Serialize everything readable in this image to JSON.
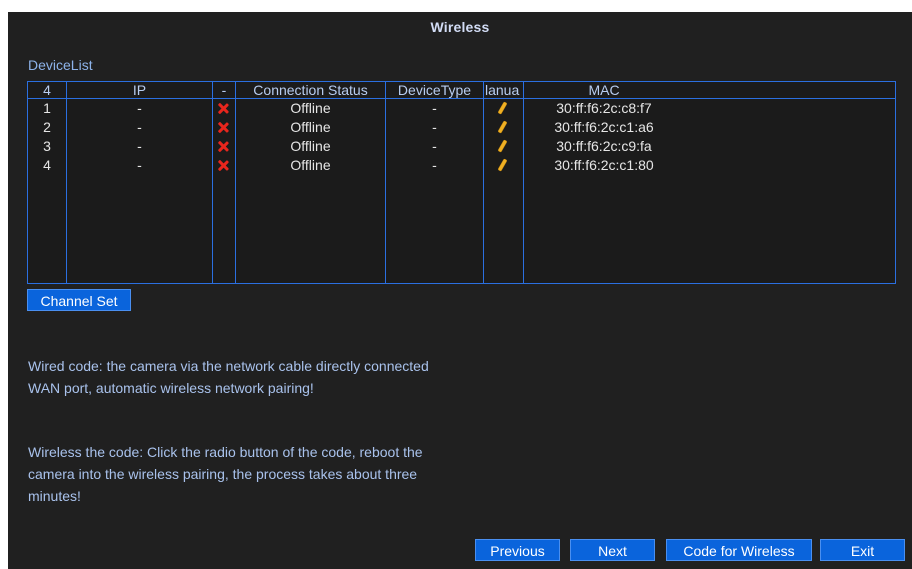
{
  "window": {
    "title": "Wireless"
  },
  "device_list": {
    "label": "DeviceList",
    "columns": [
      "4",
      "IP",
      "-",
      "Connection Status",
      "DeviceType",
      "lanua",
      "MAC"
    ],
    "rows": [
      {
        "index": "1",
        "ip": "-",
        "status": "Offline",
        "device_type": "-",
        "mac": "30:ff:f6:2c:c8:f7"
      },
      {
        "index": "2",
        "ip": "-",
        "status": "Offline",
        "device_type": "-",
        "mac": "30:ff:f6:2c:c1:a6"
      },
      {
        "index": "3",
        "ip": "-",
        "status": "Offline",
        "device_type": "-",
        "mac": "30:ff:f6:2c:c9:fa"
      },
      {
        "index": "4",
        "ip": "-",
        "status": "Offline",
        "device_type": "-",
        "mac": "30:ff:f6:2c:c1:80"
      }
    ]
  },
  "buttons": {
    "channel_set": "Channel Set",
    "previous": "Previous",
    "next": "Next",
    "code_for_wireless": "Code for Wireless",
    "exit": "Exit"
  },
  "info": {
    "wired_line1": "Wired code: the camera via the network cable directly connected",
    "wired_line2": "WAN port, automatic wireless network pairing!",
    "wireless_line1": "Wireless the code: Click the radio button of the code, reboot the",
    "wireless_line2": "camera into the wireless pairing, the process takes about three",
    "wireless_line3": "minutes!"
  },
  "icons": {
    "status": "x-icon",
    "manual": "pencil-icon"
  },
  "colors": {
    "background": "#202020",
    "accent": "#0a64dc",
    "grid": "#2b6fe0",
    "status_offline": "#e8261d"
  }
}
